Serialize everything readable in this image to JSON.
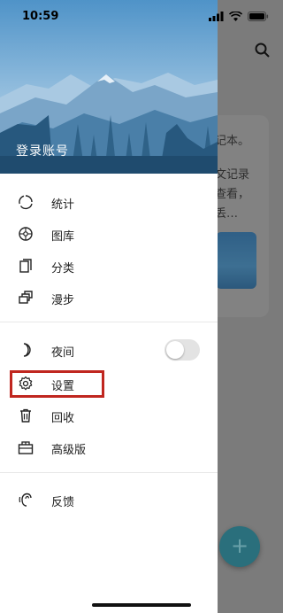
{
  "status_bar": {
    "time": "10:59"
  },
  "drawer": {
    "header": {
      "login_label": "登录账号"
    },
    "items": [
      {
        "label": "统计",
        "icon": "stats-icon"
      },
      {
        "label": "图库",
        "icon": "gallery-icon"
      },
      {
        "label": "分类",
        "icon": "category-icon"
      },
      {
        "label": "漫步",
        "icon": "wander-icon"
      },
      {
        "label": "夜间",
        "icon": "moon-icon",
        "toggle_on": false
      },
      {
        "label": "设置",
        "icon": "gear-icon"
      },
      {
        "label": "回收",
        "icon": "trash-icon"
      },
      {
        "label": "高级版",
        "icon": "premium-icon"
      },
      {
        "label": "反馈",
        "icon": "feedback-icon"
      }
    ]
  },
  "background": {
    "card_lines": [
      "记本。",
      "文记录",
      "查看，",
      "丢…"
    ]
  },
  "colors": {
    "highlight": "#c0261f",
    "fab": "#2a6f7c"
  }
}
